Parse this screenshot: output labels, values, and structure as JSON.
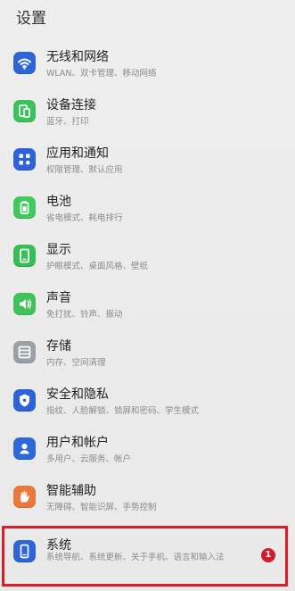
{
  "header": {
    "title": "设置"
  },
  "items": [
    {
      "label": "无线和网络",
      "subtitle": "WLAN、双卡管理、移动网络",
      "icon": "wifi-icon",
      "color": "#2d65d6"
    },
    {
      "label": "设备连接",
      "subtitle": "蓝牙、打印",
      "icon": "device-connection-icon",
      "color": "#39c35a"
    },
    {
      "label": "应用和通知",
      "subtitle": "权限管理、默认应用",
      "icon": "apps-icon",
      "color": "#2d62d8"
    },
    {
      "label": "电池",
      "subtitle": "省电模式、耗电排行",
      "icon": "battery-icon",
      "color": "#40c95c"
    },
    {
      "label": "显示",
      "subtitle": "护眼模式、桌面风格、壁纸",
      "icon": "display-icon",
      "color": "#35bf55"
    },
    {
      "label": "声音",
      "subtitle": "免打扰、铃声、振动",
      "icon": "sound-icon",
      "color": "#3fc25a"
    },
    {
      "label": "存储",
      "subtitle": "内存、空间清理",
      "icon": "storage-icon",
      "color": "#9aa0a8"
    },
    {
      "label": "安全和隐私",
      "subtitle": "指纹、人脸解锁、锁屏和密码、学生模式",
      "icon": "shield-icon",
      "color": "#2d63d7"
    },
    {
      "label": "用户和帐户",
      "subtitle": "多用户、云服务、帐户",
      "icon": "user-icon",
      "color": "#2c69d7"
    },
    {
      "label": "智能辅助",
      "subtitle": "无障碍、智能识屏、手势控制",
      "icon": "hand-icon",
      "color": "#e9793a"
    },
    {
      "label": "系统",
      "subtitle": "系统导航、系统更新、关于手机、语言和输入法",
      "icon": "system-icon",
      "color": "#2d64d7",
      "badge": "1"
    }
  ]
}
